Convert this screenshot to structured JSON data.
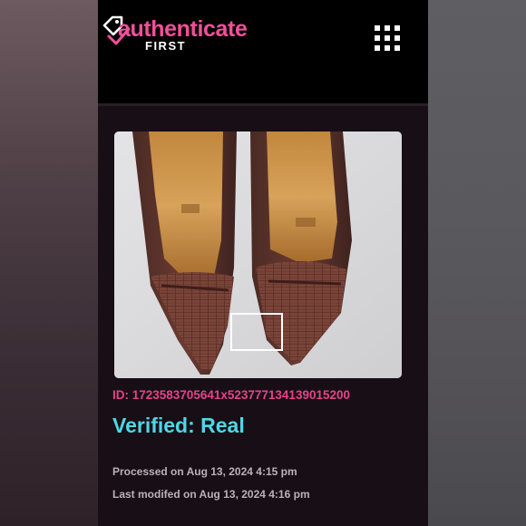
{
  "header": {
    "logo_main": "authenticate",
    "logo_sub": "FIRST",
    "logo_icon": "tag-check-icon",
    "menu_icon": "grid-menu-icon"
  },
  "result": {
    "image_subject": "brown leather loafers",
    "id_label": "ID: 1723583705641x523777134139015200",
    "verdict": "Verified: Real",
    "processed": "Processed on Aug 13, 2024 4:15 pm",
    "modified": "Last modifed on Aug 13, 2024 4:16 pm"
  },
  "colors": {
    "brand_pink": "#f0509a",
    "id_pink": "#e9418c",
    "verdict_cyan": "#4fd6e8",
    "meta_gray": "#b8b2b8",
    "page_bg": "#170f15"
  }
}
